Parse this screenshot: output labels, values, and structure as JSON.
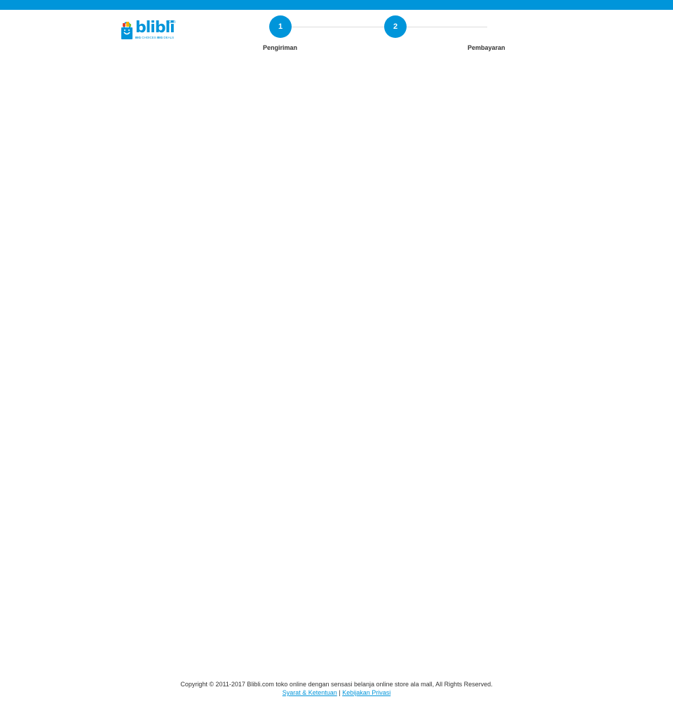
{
  "brand": {
    "logo_text": "blibli",
    "logo_suffix": "com",
    "tagline_1": "BIG",
    "tagline_2": "CHOICES",
    "tagline_3": "BIG",
    "tagline_4": "DEALS",
    "color": "#0095da"
  },
  "stepper": {
    "steps": [
      {
        "number": "1",
        "label": "Pengiriman"
      },
      {
        "number": "2",
        "label": "Pembayaran"
      }
    ]
  },
  "footer": {
    "copyright": "Copyright © 2011-2017 Blibli.com toko online dengan sensasi belanja online store ala mall, All Rights Reserved.",
    "terms_link": "Syarat & Ketentuan",
    "separator": "|",
    "privacy_link": "Kebijakan Privasi"
  }
}
